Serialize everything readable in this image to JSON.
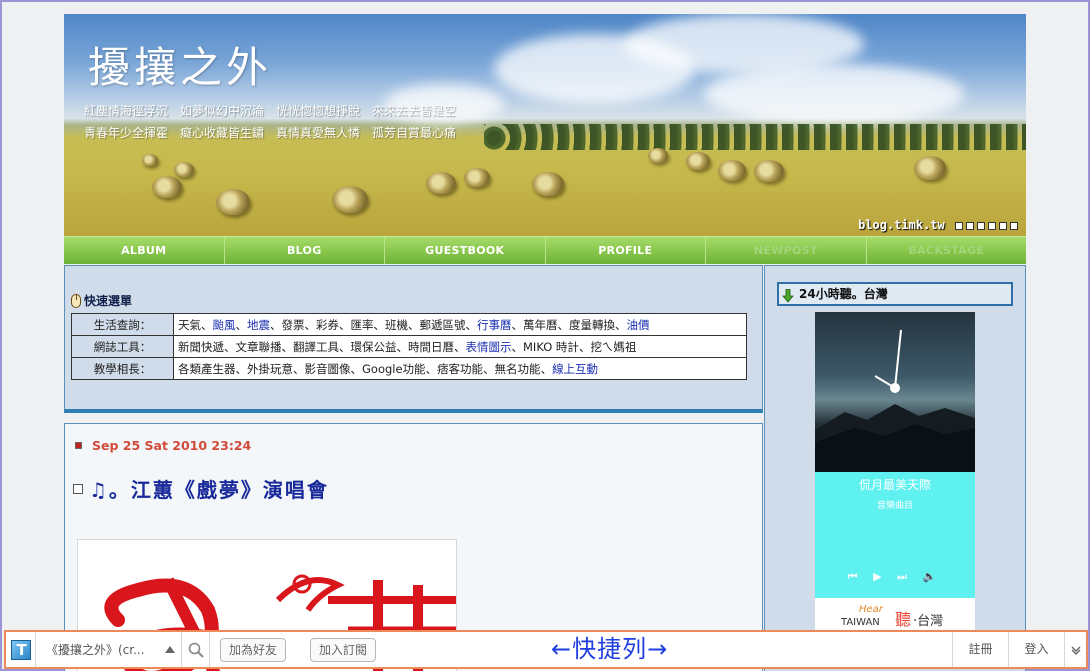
{
  "header": {
    "title": "擾攘之外",
    "subtitle_line1": "紅塵情海徑浮沉　如夢似幻中沉淪　恍恍惚惚想掙脫　來來去去皆是空",
    "subtitle_line2": "青春年少全揮霍　癡心收藏皆生鏽　真情真愛無人憐　孤芳自賞最心痛",
    "site_url": "blog.timk.tw"
  },
  "nav": {
    "items": [
      {
        "label": "ALBUM"
      },
      {
        "label": "BLOG"
      },
      {
        "label": "GUESTBOOK"
      },
      {
        "label": "PROFILE"
      },
      {
        "label": "NEWPOST"
      },
      {
        "label": "BACKSTAGE"
      }
    ]
  },
  "quick_menu": {
    "title": "快速選單",
    "rows": [
      {
        "category": "生活查詢：",
        "links": [
          {
            "text": "天氣",
            "hl": false
          },
          {
            "text": "颱風",
            "hl": true
          },
          {
            "text": "地震",
            "hl": true
          },
          {
            "text": "發票",
            "hl": false
          },
          {
            "text": "彩券",
            "hl": false
          },
          {
            "text": "匯率",
            "hl": false
          },
          {
            "text": "班機",
            "hl": false
          },
          {
            "text": "郵遞區號",
            "hl": false
          },
          {
            "text": "行事曆",
            "hl": true
          },
          {
            "text": "萬年曆",
            "hl": false
          },
          {
            "text": "度量轉換",
            "hl": false
          },
          {
            "text": "油價",
            "hl": true
          }
        ]
      },
      {
        "category": "網誌工具：",
        "links": [
          {
            "text": "新聞快遞",
            "hl": false
          },
          {
            "text": "文章聯播",
            "hl": false
          },
          {
            "text": "翻譯工具",
            "hl": false
          },
          {
            "text": "環保公益",
            "hl": false
          },
          {
            "text": "時間日曆",
            "hl": false
          },
          {
            "text": "表情圖示",
            "hl": true
          },
          {
            "text": "MIKO 時計",
            "hl": false
          },
          {
            "text": "挖ㄟ媽祖",
            "hl": false
          }
        ]
      },
      {
        "category": "教學相長：",
        "links": [
          {
            "text": "各類產生器",
            "hl": false
          },
          {
            "text": "外掛玩意",
            "hl": false
          },
          {
            "text": "影音圖像",
            "hl": false
          },
          {
            "text": "Google功能",
            "hl": false
          },
          {
            "text": "痞客功能",
            "hl": false
          },
          {
            "text": "無名功能",
            "hl": false
          },
          {
            "text": "線上互動",
            "hl": true
          }
        ]
      }
    ]
  },
  "post": {
    "date": "Sep 25 Sat 2010 23:24",
    "title": "♫。江蕙《戲夢》演唱會"
  },
  "sidebar": {
    "title": "24小時聽。台灣",
    "player": {
      "song": "侃月最美天際",
      "artist": "音樂曲目",
      "controls": "⏮ ▶ ⏭ 🔈",
      "logo_hear": "Hear",
      "logo_taiwan": "TAIWAN",
      "logo_ting": "聽",
      "logo_tw": "·台灣"
    }
  },
  "toolbar": {
    "blog_select": "《擾攘之外》(cr...",
    "add_friend": "加為好友",
    "subscribe": "加入訂閱",
    "center_label": "←快捷列→",
    "register": "註冊",
    "login": "登入"
  },
  "colors": {
    "nav_green": "#86c54a",
    "link_blue": "#1a2fb0",
    "date_red": "#d24a3a",
    "title_blue": "#1a2a9a",
    "toolbar_border": "#ee8a5a",
    "player_cyan": "#5ff0f0"
  }
}
